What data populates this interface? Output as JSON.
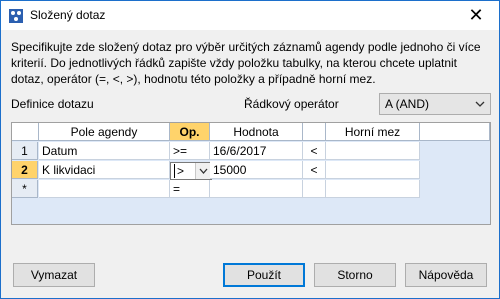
{
  "window": {
    "title": "Složený dotaz"
  },
  "description": "Specifikujte zde složený dotaz pro výběr určitých záznamů agendy podle jednoho či více kriterií. Do jednotlivých řádků zapište vždy položku tabulky, na kterou chcete uplatnit dotaz, operátor (=, <, >), hodnotu této položky a případně horní mez.",
  "labels": {
    "definition": "Definice dotazu",
    "row_operator": "Řádkový operátor"
  },
  "row_operator_combo": {
    "value": "A (AND)"
  },
  "grid": {
    "headers": {
      "field": "Pole agendy",
      "op": "Op.",
      "value": "Hodnota",
      "upper": "Horní mez"
    },
    "rows": [
      {
        "num": "1",
        "field": "Datum",
        "op": ">=",
        "value": "16/6/2017",
        "arrow": "<",
        "upper": ""
      },
      {
        "num": "2",
        "field": "K likvidaci",
        "op": ">",
        "value": "15000",
        "arrow": "<",
        "upper": ""
      },
      {
        "num": "*",
        "field": "",
        "op": "=",
        "value": "",
        "arrow": "",
        "upper": ""
      }
    ]
  },
  "buttons": {
    "clear": "Vymazat",
    "apply": "Použít",
    "cancel": "Storno",
    "help": "Nápověda"
  },
  "icons": {
    "app": "query-icon",
    "close": "close-icon",
    "dropdown": "chevron-down-icon"
  },
  "colors": {
    "accent": "#0078d7",
    "header_active": "#ffd36b",
    "grid_bg": "#dde8f7"
  }
}
